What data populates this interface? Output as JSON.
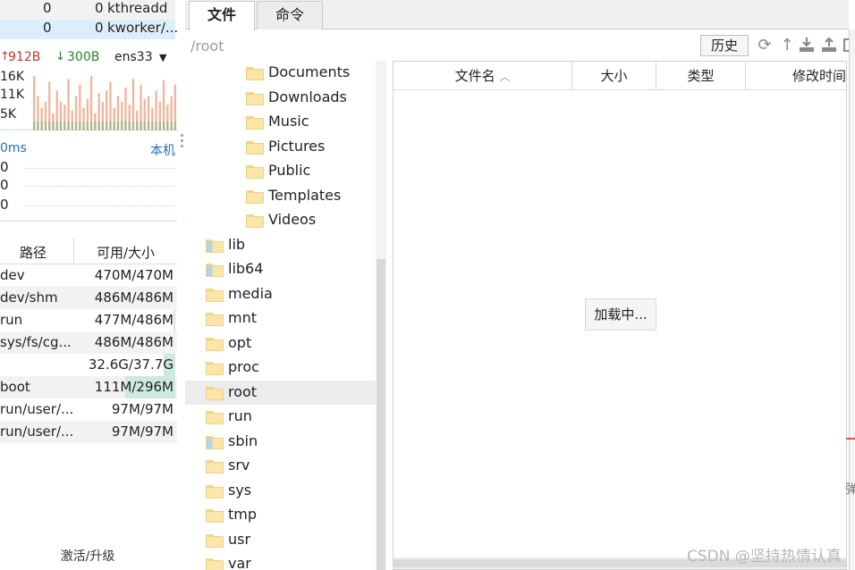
{
  "processes": [
    {
      "col1": "0",
      "col2": "0",
      "name": "kthreadd"
    },
    {
      "col1": "0",
      "col2": "0",
      "name": "kworker/..."
    }
  ],
  "network": {
    "up": "912B",
    "down": "300B",
    "interface": "ens33",
    "y_labels": [
      "16K",
      "11K",
      "5K"
    ],
    "up_color": "#f2b49a",
    "down_color": "#9ab58a",
    "bars_up": [
      0.95,
      0.6,
      0.4,
      0.5,
      0.85,
      0.3,
      0.7,
      0.5,
      0.45,
      0.9,
      0.35,
      0.6,
      0.8,
      0.4,
      0.55,
      0.95,
      0.3,
      0.65,
      0.5,
      0.7,
      0.85,
      0.4,
      0.6,
      0.5,
      0.75,
      0.45,
      0.9,
      0.35,
      0.8,
      0.55,
      0.6,
      0.4,
      0.7,
      0.5,
      0.88,
      0.45,
      0.6,
      0.8
    ]
  },
  "latency": {
    "left": "0ms",
    "right": "本机",
    "values": [
      "0",
      "0",
      "0"
    ]
  },
  "disks": {
    "headers": {
      "path": "路径",
      "size": "可用/大小"
    },
    "rows": [
      {
        "path": "dev",
        "size": "470M/470M",
        "used": 0.0
      },
      {
        "path": "dev/shm",
        "size": "486M/486M",
        "used": 0.0
      },
      {
        "path": "run",
        "size": "477M/486M",
        "used": 0.02
      },
      {
        "path": "sys/fs/cg...",
        "size": "486M/486M",
        "used": 0.0
      },
      {
        "path": "",
        "size": "32.6G/37.7G",
        "used": 0.14
      },
      {
        "path": "boot",
        "size": "111M/296M",
        "used": 0.62
      },
      {
        "path": "run/user/...",
        "size": "97M/97M",
        "used": 0.0
      },
      {
        "path": "run/user/...",
        "size": "97M/97M",
        "used": 0.0
      }
    ],
    "used_color": "#cde8df"
  },
  "upgrade_label": "激活/升级",
  "tabs": {
    "files": "文件",
    "commands": "命令"
  },
  "path": "/root",
  "history_button": "历史",
  "tree": [
    {
      "name": "Documents",
      "indent": 2,
      "link": false,
      "selected": false
    },
    {
      "name": "Downloads",
      "indent": 2,
      "link": false,
      "selected": false
    },
    {
      "name": "Music",
      "indent": 2,
      "link": false,
      "selected": false
    },
    {
      "name": "Pictures",
      "indent": 2,
      "link": false,
      "selected": false
    },
    {
      "name": "Public",
      "indent": 2,
      "link": false,
      "selected": false
    },
    {
      "name": "Templates",
      "indent": 2,
      "link": false,
      "selected": false
    },
    {
      "name": "Videos",
      "indent": 2,
      "link": false,
      "selected": false
    },
    {
      "name": "lib",
      "indent": 1,
      "link": true,
      "selected": false
    },
    {
      "name": "lib64",
      "indent": 1,
      "link": true,
      "selected": false
    },
    {
      "name": "media",
      "indent": 1,
      "link": false,
      "selected": false
    },
    {
      "name": "mnt",
      "indent": 1,
      "link": false,
      "selected": false
    },
    {
      "name": "opt",
      "indent": 1,
      "link": false,
      "selected": false
    },
    {
      "name": "proc",
      "indent": 1,
      "link": false,
      "selected": false
    },
    {
      "name": "root",
      "indent": 1,
      "link": false,
      "selected": true
    },
    {
      "name": "run",
      "indent": 1,
      "link": false,
      "selected": false
    },
    {
      "name": "sbin",
      "indent": 1,
      "link": true,
      "selected": false
    },
    {
      "name": "srv",
      "indent": 1,
      "link": false,
      "selected": false
    },
    {
      "name": "sys",
      "indent": 1,
      "link": false,
      "selected": false
    },
    {
      "name": "tmp",
      "indent": 1,
      "link": false,
      "selected": false
    },
    {
      "name": "usr",
      "indent": 1,
      "link": false,
      "selected": false
    },
    {
      "name": "var",
      "indent": 1,
      "link": false,
      "selected": false
    }
  ],
  "columns": {
    "name": "文件名",
    "size": "大小",
    "type": "类型",
    "modified": "修改时间"
  },
  "loading_label": "加载中...",
  "edge_glyph": "弹",
  "watermark": "CSDN @坚持热情认真"
}
